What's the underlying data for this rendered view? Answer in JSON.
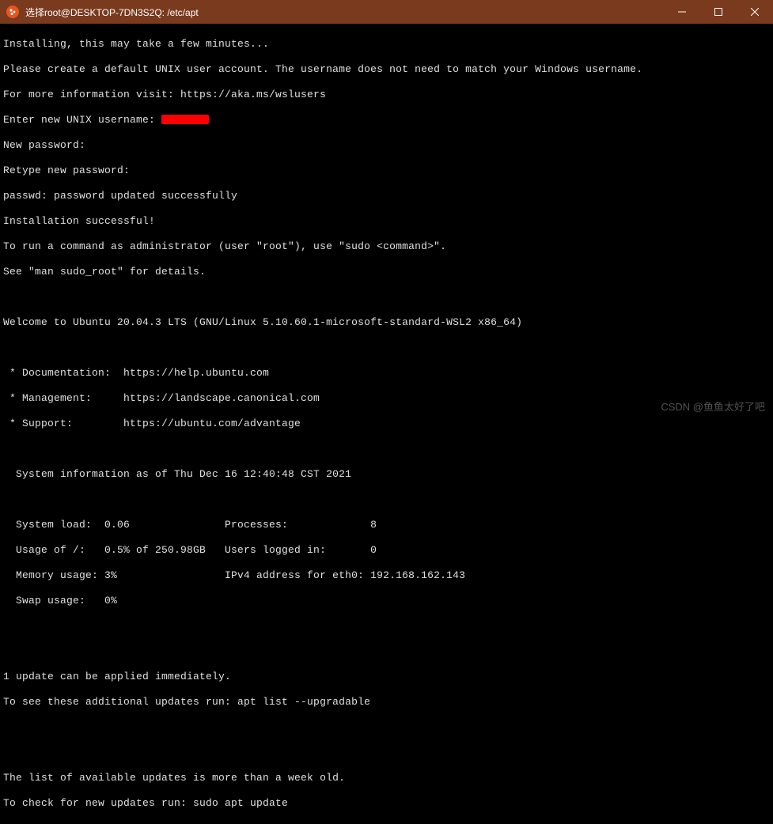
{
  "window": {
    "title": "选择root@DESKTOP-7DN3S2Q: /etc/apt"
  },
  "terminal": {
    "lines": {
      "l01": "Installing, this may take a few minutes...",
      "l02": "Please create a default UNIX user account. The username does not need to match your Windows username.",
      "l03": "For more information visit: https://aka.ms/wslusers",
      "l04": "Enter new UNIX username: ",
      "l05": "New password:",
      "l06": "Retype new password:",
      "l07": "passwd: password updated successfully",
      "l08": "Installation successful!",
      "l09": "To run a command as administrator (user \"root\"), use \"sudo <command>\".",
      "l10": "See \"man sudo_root\" for details.",
      "l11": "",
      "l12": "Welcome to Ubuntu 20.04.3 LTS (GNU/Linux 5.10.60.1-microsoft-standard-WSL2 x86_64)",
      "l13": "",
      "l14": " * Documentation:  https://help.ubuntu.com",
      "l15": " * Management:     https://landscape.canonical.com",
      "l16": " * Support:        https://ubuntu.com/advantage",
      "l17": "",
      "l18": "  System information as of Thu Dec 16 12:40:48 CST 2021",
      "l19": "",
      "l20": "  System load:  0.06               Processes:             8",
      "l21": "  Usage of /:   0.5% of 250.98GB   Users logged in:       0",
      "l22": "  Memory usage: 3%                 IPv4 address for eth0: 192.168.162.143",
      "l23": "  Swap usage:   0%",
      "l24": "",
      "l25": "",
      "l26": "1 update can be applied immediately.",
      "l27": "To see these additional updates run: apt list --upgradable",
      "l28": "",
      "l29": "",
      "l30": "The list of available updates is more than a week old.",
      "l31": "To check for new updates run: sudo apt update"
    }
  },
  "watermark": "CSDN @鱼鱼太好了吧"
}
